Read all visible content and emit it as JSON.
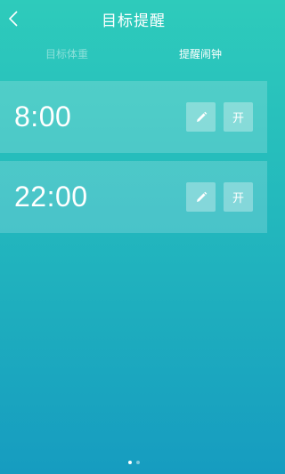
{
  "header": {
    "title": "目标提醒",
    "back_icon": "chevron-left-icon"
  },
  "tabs": [
    {
      "label": "目标体重",
      "active": false
    },
    {
      "label": "提醒闹钟",
      "active": true
    }
  ],
  "alarms": [
    {
      "time": "8:00",
      "edit_icon": "pencil-icon",
      "toggle_label": "开"
    },
    {
      "time": "22:00",
      "edit_icon": "pencil-icon",
      "toggle_label": "开"
    }
  ],
  "pager": {
    "pages": 2,
    "current": 1
  },
  "colors": {
    "gradient_top": "#2ecbbb",
    "gradient_bottom": "#169cc0",
    "text": "#ffffff"
  }
}
